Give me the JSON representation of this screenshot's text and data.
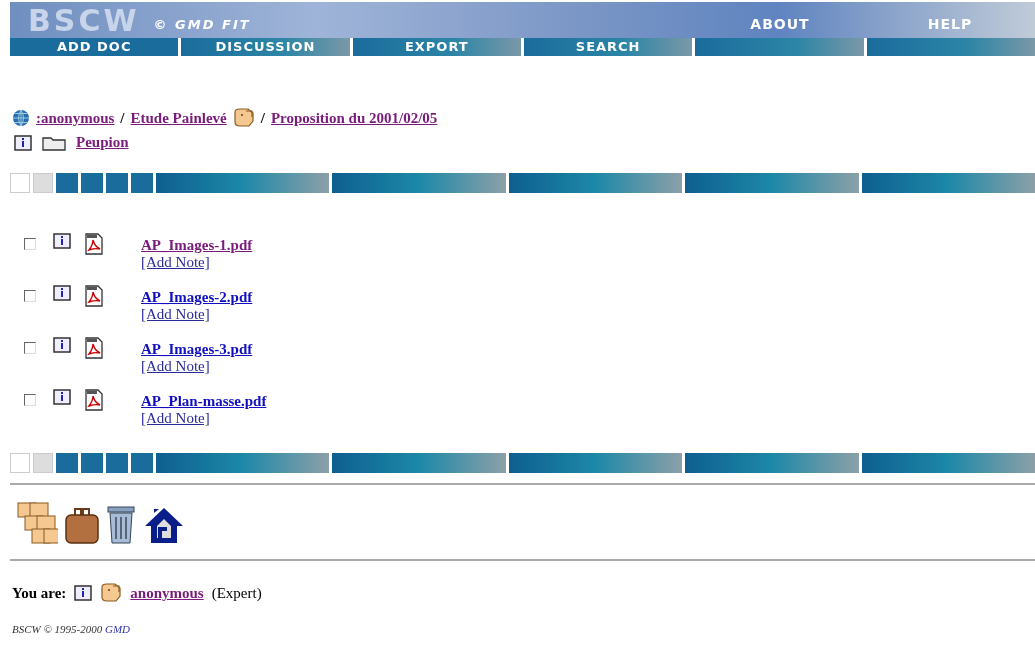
{
  "banner": {
    "logo": "BSCW",
    "copyright": "© GMD FIT",
    "links": [
      "ABOUT",
      "HELP"
    ]
  },
  "nav": {
    "buttons": [
      "ADD DOC",
      "DISCUSSION",
      "EXPORT",
      "SEARCH"
    ]
  },
  "breadcrumb": [
    {
      "label": ":anonymous",
      "visited": true
    },
    {
      "separator": "/",
      "label": "Etude Painlevé",
      "visited": true
    },
    {
      "separator": "/",
      "label": "Proposition du 2001/02/05",
      "visited": true
    }
  ],
  "folder": {
    "label": "Peupion",
    "visited": true
  },
  "files": [
    {
      "name": "AP_Images-1.pdf",
      "visited": true,
      "checked": false,
      "note": "[Add Note]"
    },
    {
      "name": "AP_Images-2.pdf",
      "visited": false,
      "checked": false,
      "note": "[Add Note]"
    },
    {
      "name": "AP_Images-3.pdf",
      "visited": false,
      "checked": false,
      "note": "[Add Note]"
    },
    {
      "name": "AP_Plan-masse.pdf",
      "visited": false,
      "checked": false,
      "note": "[Add Note]"
    }
  ],
  "user": {
    "label": "You are:",
    "name": "anonymous",
    "role": "(Expert)"
  },
  "footer": {
    "text": "BSCW © 1995-2000",
    "link": "GMD"
  }
}
